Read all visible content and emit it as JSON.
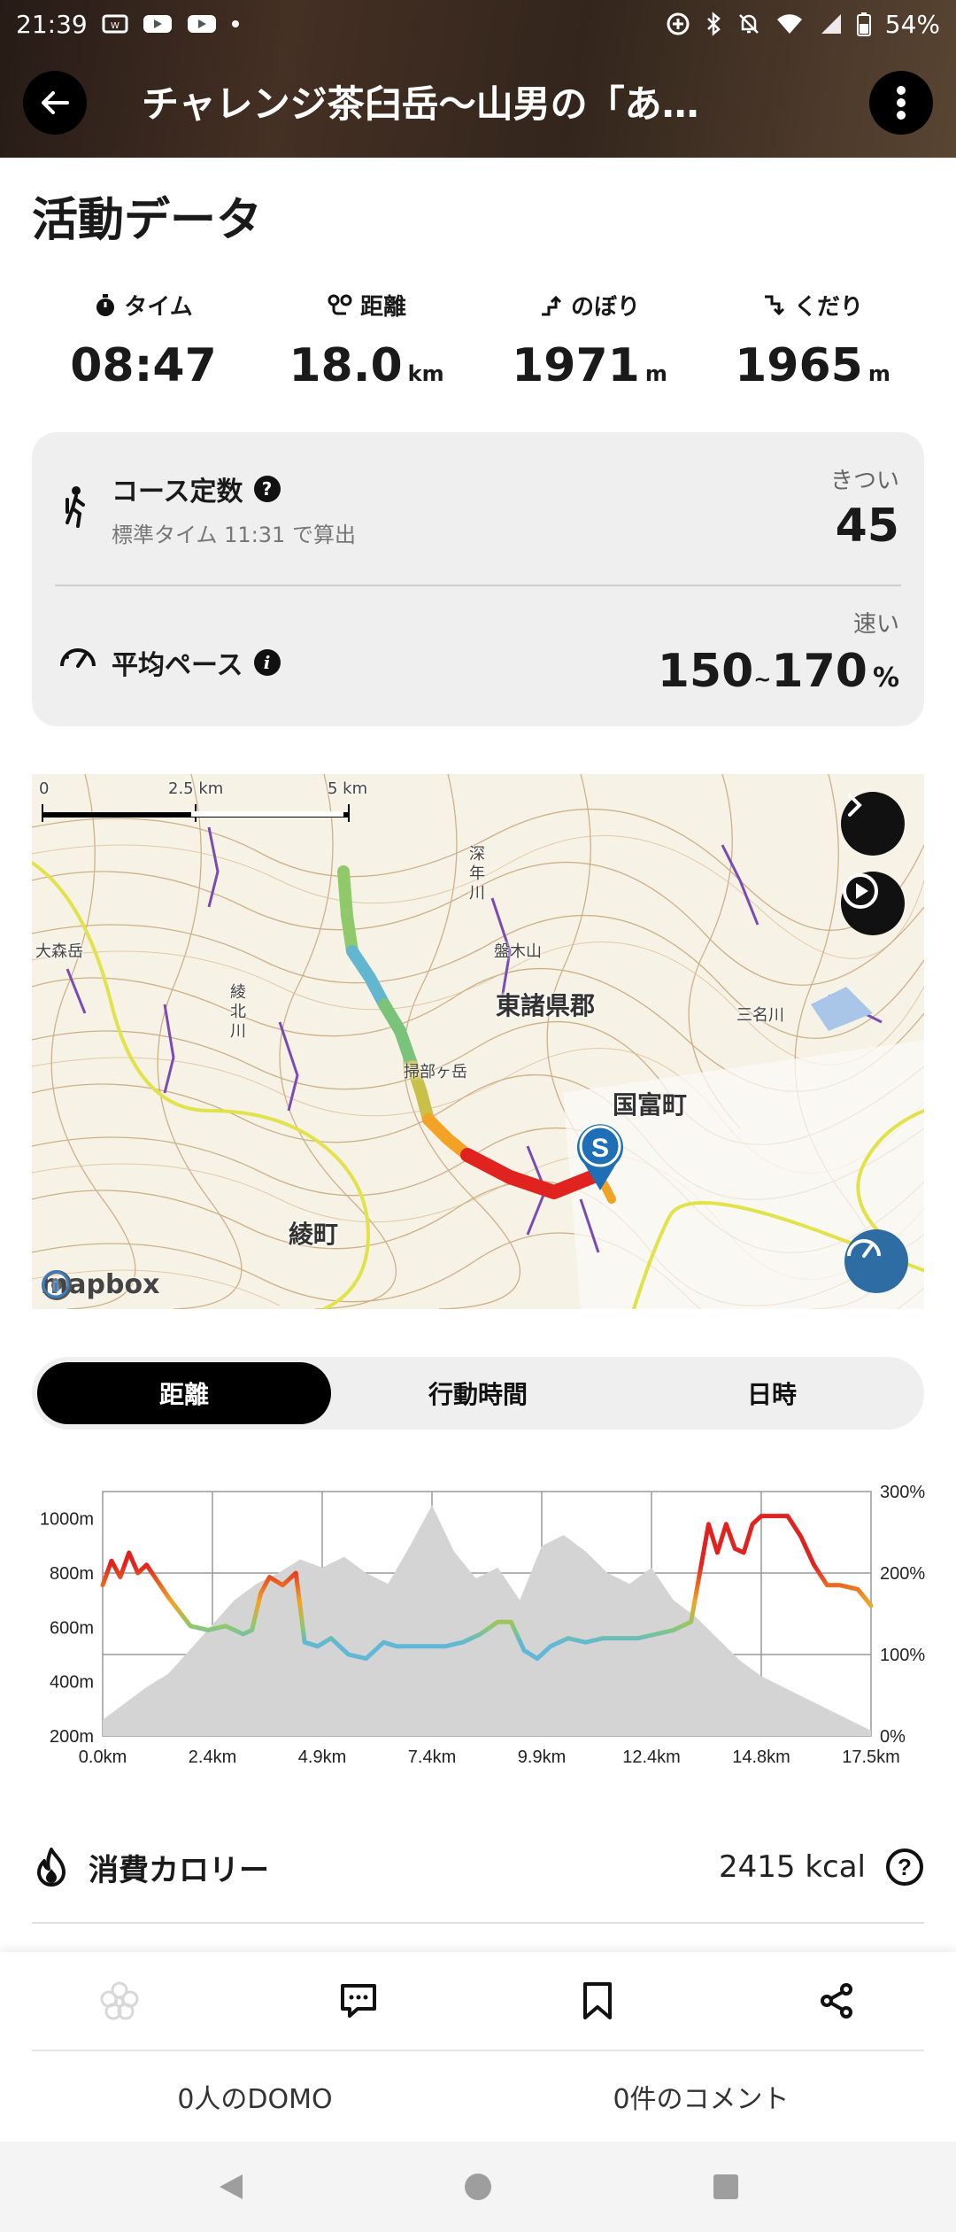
{
  "status_bar": {
    "time": "21:39",
    "battery": "54%"
  },
  "header": {
    "title": "チャレンジ茶臼岳〜山男の「あ…"
  },
  "section_title": "活動データ",
  "stats": [
    {
      "label": "タイム",
      "value": "08:47",
      "unit": "",
      "icon": "stopwatch-icon"
    },
    {
      "label": "距離",
      "value": "18.0",
      "unit": "km",
      "icon": "route-icon"
    },
    {
      "label": "のぼり",
      "value": "1971",
      "unit": "m",
      "icon": "ascent-icon"
    },
    {
      "label": "くだり",
      "value": "1965",
      "unit": "m",
      "icon": "descent-icon"
    }
  ],
  "course": {
    "label": "コース定数",
    "sub": "標準タイム 11:31 で算出",
    "level": "きつい",
    "value": "45"
  },
  "pace": {
    "label": "平均ペース",
    "level": "速い",
    "low": "150",
    "sep": "~",
    "high": "170",
    "unit": "%"
  },
  "map": {
    "scale": [
      "0",
      "2.5 km",
      "5 km"
    ],
    "labels": [
      "東諸県郡",
      "国富町",
      "綾町",
      "大森岳",
      "盤木山",
      "綾北川",
      "深年川",
      "三名川",
      "掃部ヶ岳"
    ],
    "start_marker": "S",
    "attribution": "mapbox"
  },
  "tabs": [
    "距離",
    "行動時間",
    "日時"
  ],
  "active_tab": 0,
  "chart_data": {
    "type": "line",
    "x_ticks": [
      "0.0km",
      "2.4km",
      "4.9km",
      "7.4km",
      "9.9km",
      "12.4km",
      "14.8km",
      "17.5km"
    ],
    "y_left_ticks": [
      "1000m",
      "800m",
      "600m",
      "400m",
      "200m"
    ],
    "y_right_ticks": [
      "300%",
      "200%",
      "100%",
      "0%"
    ],
    "xlim": [
      0,
      17.5
    ],
    "ylim_elevation": [
      200,
      1100
    ],
    "ylim_pace": [
      0,
      300
    ],
    "series": [
      {
        "x": [
          0,
          0.5,
          1,
          1.5,
          2,
          2.5,
          3,
          3.5,
          4,
          4.5,
          5,
          5.5,
          6,
          6.5,
          7,
          7.5,
          8,
          8.5,
          9,
          9.5,
          10,
          10.5,
          11,
          11.5,
          12,
          12.5,
          13,
          13.5,
          14,
          14.5,
          15,
          15.5,
          16,
          16.5,
          17,
          17.5
        ],
        "values": [
          260,
          320,
          380,
          430,
          520,
          610,
          700,
          760,
          800,
          850,
          820,
          860,
          800,
          760,
          900,
          1050,
          880,
          780,
          820,
          700,
          900,
          940,
          880,
          800,
          760,
          820,
          700,
          640,
          560,
          480,
          420,
          380,
          340,
          300,
          260,
          220
        ]
      },
      {
        "x": [
          0,
          0.2,
          0.4,
          0.6,
          0.8,
          1,
          1.5,
          2,
          2.4,
          2.8,
          3.2,
          3.4,
          3.6,
          3.8,
          4.1,
          4.4,
          4.6,
          4.9,
          5.2,
          5.6,
          6,
          6.4,
          6.7,
          7,
          7.4,
          7.8,
          8.2,
          8.6,
          9,
          9.3,
          9.6,
          9.9,
          10.2,
          10.6,
          11,
          11.4,
          11.8,
          12.2,
          12.6,
          13,
          13.4,
          13.8,
          14,
          14.2,
          14.4,
          14.6,
          14.8,
          15,
          15.3,
          15.6,
          15.9,
          16.2,
          16.5,
          16.8,
          17.2,
          17.5
        ],
        "values": [
          185,
          215,
          195,
          225,
          200,
          210,
          170,
          135,
          130,
          135,
          125,
          130,
          175,
          195,
          185,
          200,
          115,
          110,
          120,
          100,
          95,
          115,
          110,
          110,
          110,
          110,
          115,
          125,
          140,
          140,
          105,
          95,
          110,
          120,
          115,
          120,
          120,
          120,
          125,
          130,
          140,
          260,
          225,
          260,
          230,
          225,
          260,
          270,
          270,
          270,
          245,
          210,
          185,
          185,
          180,
          160
        ]
      }
    ]
  },
  "calories": {
    "label": "消費カロリー",
    "value": "2415 kcal"
  },
  "counts": {
    "domo": "0人のDOMO",
    "comments": "0件のコメント"
  }
}
